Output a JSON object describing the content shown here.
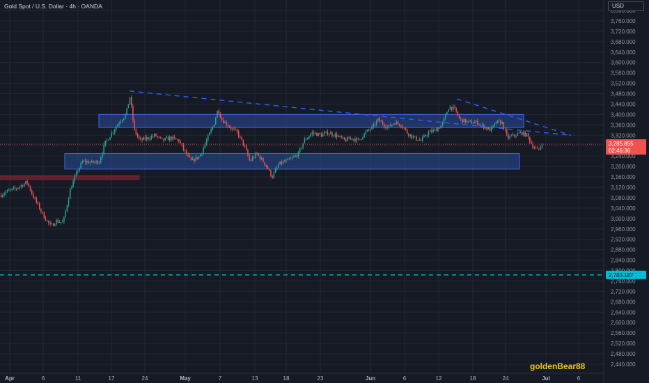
{
  "header": {
    "symbol_title": "Gold Spot / U.S. Dollar · 4h · OANDA",
    "currency": "USD"
  },
  "watermark": "goldenBear88",
  "colors": {
    "background": "#161a25",
    "grid": "#232838",
    "up_candle": "#26a69a",
    "down_candle": "#ef5350",
    "zone_fill": "#2a4a9a",
    "zone_border": "#4169e1",
    "red_zone": "#7a2430",
    "trendline": "#2962ff",
    "support_line": "#00bcd4",
    "price_label": "#ef5350",
    "axis_text": "#9598a1",
    "watermark": "#f0c419"
  },
  "price_axis": {
    "ticks": [
      "3,800.000",
      "3,760.000",
      "3,720.000",
      "3,680.000",
      "3,640.000",
      "3,600.000",
      "3,560.000",
      "3,520.000",
      "3,480.000",
      "3,440.000",
      "3,400.000",
      "3,360.000",
      "3,320.000",
      "3,280.000",
      "3,240.000",
      "3,200.000",
      "3,160.000",
      "3,120.000",
      "3,080.000",
      "3,040.000",
      "3,000.000",
      "2,960.000",
      "2,920.000",
      "2,880.000",
      "2,840.000",
      "2,800.000",
      "2,760.000",
      "2,720.000",
      "2,680.000",
      "2,640.000",
      "2,600.000",
      "2,560.000",
      "2,520.000",
      "2,480.000",
      "2,440.000"
    ]
  },
  "time_axis": {
    "labels": [
      "Apr",
      "6",
      "11",
      "17",
      "24",
      "May",
      "7",
      "13",
      "18",
      "23",
      "Jun",
      "6",
      "12",
      "18",
      "24",
      "Jul",
      "6"
    ],
    "bold": [
      true,
      false,
      false,
      false,
      false,
      true,
      false,
      false,
      false,
      false,
      true,
      false,
      false,
      false,
      false,
      true,
      false
    ]
  },
  "current_price": {
    "value": "3,285.855",
    "countdown": "02:46:36",
    "level": 3285.855
  },
  "support_level": {
    "value": "2,783.187",
    "level": 2783.187
  },
  "zones": {
    "upper_zone": {
      "from": 3350,
      "to": 3400
    },
    "lower_zone": {
      "from": 3190,
      "to": 3250
    },
    "red_zone": {
      "from": 3150,
      "to": 3165
    }
  },
  "trendlines": [
    {
      "from": 3490,
      "to": 3320,
      "segment": "left"
    },
    {
      "from": 3460,
      "to": 3320,
      "segment": "right"
    }
  ]
}
